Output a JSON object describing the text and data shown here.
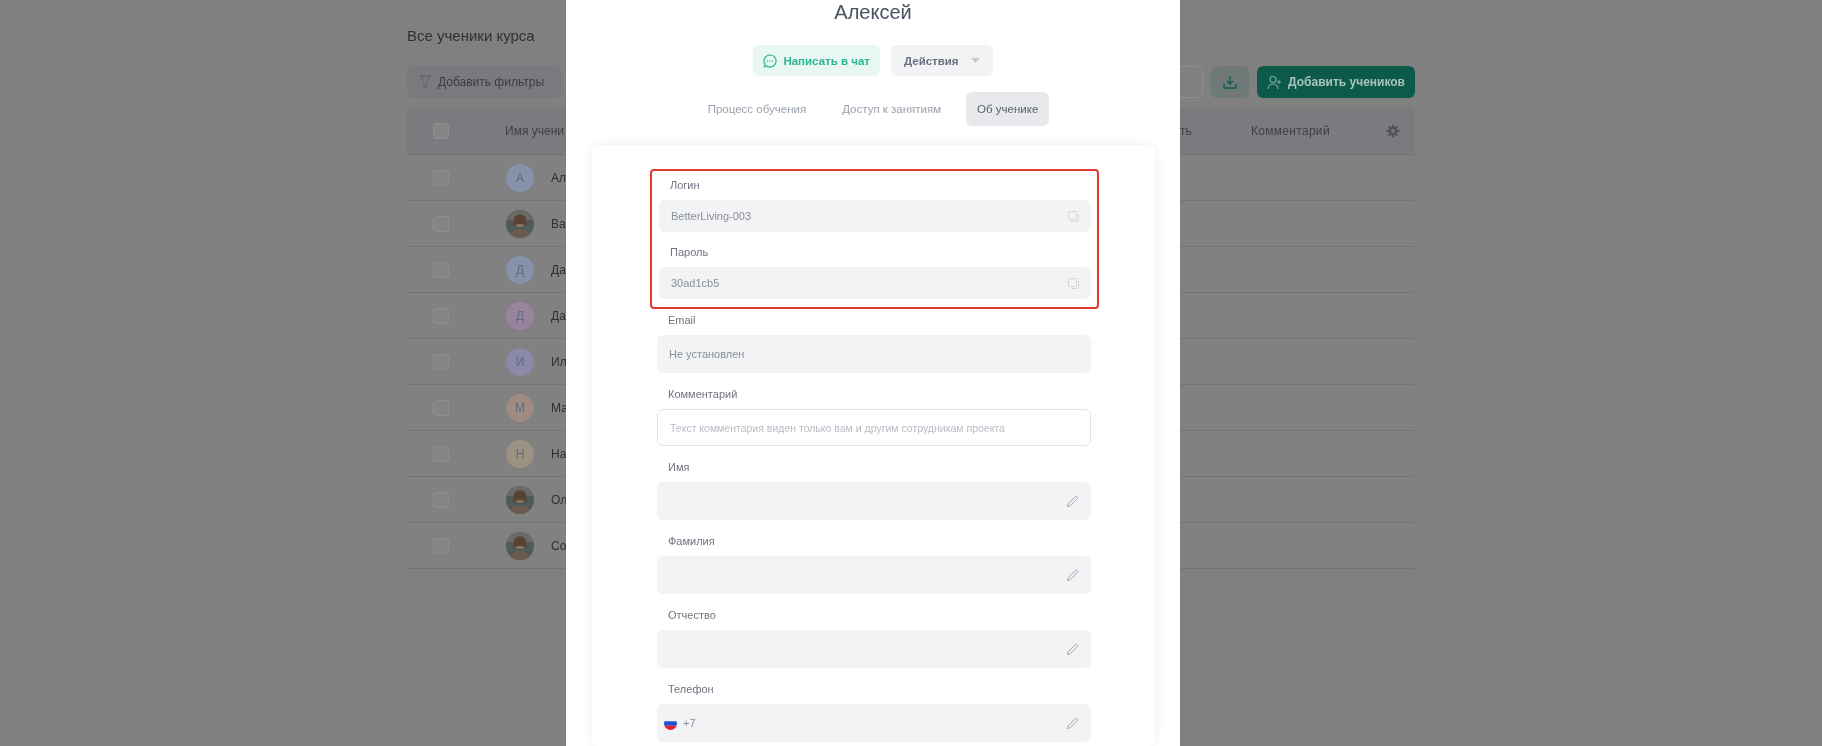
{
  "page": {
    "title": "Все ученики курса",
    "filter_button": "Добавить фильтры",
    "add_button": "Добавить учеников"
  },
  "table": {
    "select_all_checked": false,
    "columns": [
      {
        "label": "Имя учени"
      },
      {
        "label": "ть"
      },
      {
        "label": "Комментарий"
      }
    ],
    "rows": [
      {
        "avatar": {
          "kind": "letter",
          "letter": "А",
          "color": "#8593aa"
        },
        "name": "Ал",
        "checked": false
      },
      {
        "name": "Ва",
        "checked": false
      },
      {
        "avatar": {
          "kind": "letter",
          "letter": "Д",
          "color": "#8593aa"
        },
        "name": "Да",
        "checked": false
      },
      {
        "avatar": {
          "kind": "letter",
          "letter": "Д",
          "color": "#9a849d"
        },
        "name": "Да",
        "checked": false
      },
      {
        "avatar": {
          "kind": "letter",
          "letter": "И",
          "color": "#8c88a8"
        },
        "name": "Ил",
        "checked": false
      },
      {
        "avatar": {
          "kind": "letter",
          "letter": "М",
          "color": "#a08a84"
        },
        "name": "Ма",
        "checked": false
      },
      {
        "avatar": {
          "kind": "letter",
          "letter": "Н",
          "color": "#9d9282"
        },
        "name": "На",
        "checked": false
      },
      {
        "name": "Ол",
        "checked": false
      },
      {
        "name": "Со",
        "checked": false
      }
    ]
  },
  "modal": {
    "title": "Алексей",
    "chat_button": "Написать в чат",
    "actions_button": "Действия",
    "tabs": [
      {
        "label": "Процесс обучения",
        "selected": false
      },
      {
        "label": "Доступ к занятиям",
        "selected": false
      },
      {
        "label": "Об ученике",
        "selected": true
      }
    ],
    "highlighted_fields": [
      {
        "kind": "copy",
        "label": "Логин",
        "value": "BetterLiving-003"
      },
      {
        "kind": "copy",
        "label": "Пароль",
        "value": "30ad1cb5"
      }
    ],
    "fields": [
      {
        "kind": "static",
        "label": "Email",
        "value": "Не установлен"
      },
      {
        "kind": "textarea",
        "label": "Комментарий",
        "placeholder": "Текст комментария виден только вам и другим сотрудникам проекта"
      },
      {
        "kind": "edit",
        "label": "Имя"
      },
      {
        "kind": "edit",
        "label": "Фамилия"
      },
      {
        "kind": "edit",
        "label": "Отчество"
      },
      {
        "kind": "phone",
        "label": "Телефон",
        "value": "+7"
      }
    ]
  }
}
